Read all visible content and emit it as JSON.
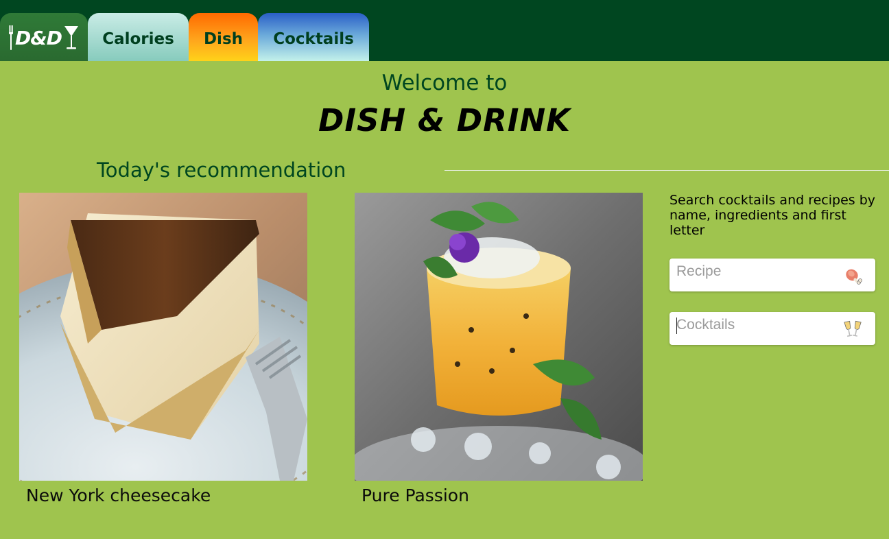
{
  "nav": {
    "logo_text": "D&D",
    "tabs": [
      {
        "label": "Calories"
      },
      {
        "label": "Dish"
      },
      {
        "label": "Cocktails"
      }
    ]
  },
  "hero": {
    "welcome": "Welcome to",
    "brand": "DISH & DRINK"
  },
  "recommendation": {
    "title": "Today's recommendation",
    "items": [
      {
        "name": "New York cheesecake",
        "image": "cheesecake-slice-photo"
      },
      {
        "name": "Pure Passion",
        "image": "passion-fruit-cocktail-photo"
      }
    ]
  },
  "search": {
    "description": "Search cocktails and recipes by name, ingredients and first letter",
    "recipe_placeholder": "Recipe",
    "recipe_icon": "meat-on-bone-icon",
    "cocktails_placeholder": "Cocktails",
    "cocktails_icon": "clinking-glasses-icon"
  },
  "colors": {
    "background": "#9fc44e",
    "topbar": "#004620",
    "heading_green": "#004620"
  }
}
